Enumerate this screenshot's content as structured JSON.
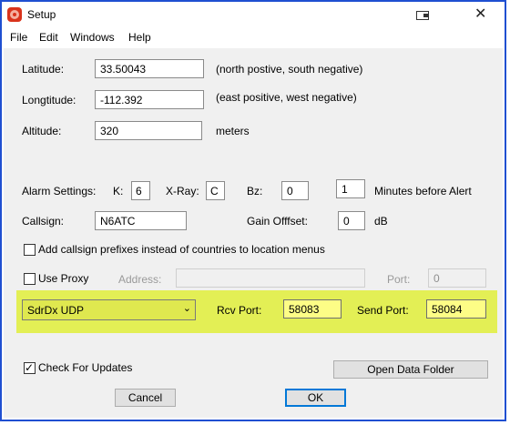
{
  "window": {
    "title": "Setup"
  },
  "menu": [
    "File",
    "Edit",
    "Windows",
    "Help"
  ],
  "location": {
    "latitude_label": "Latitude:",
    "latitude_value": "33.50043",
    "latitude_note": "(north postive, south negative)",
    "longitude_label": "Longtitude:",
    "longitude_value": "-112.392",
    "longitude_note": "(east positive, west negative)",
    "altitude_label": "Altitude:",
    "altitude_value": "320",
    "altitude_unit": "meters"
  },
  "alarm": {
    "label": "Alarm Settings:",
    "k_label": "K:",
    "k_value": "6",
    "xray_label": "X-Ray:",
    "xray_value": "C",
    "bz_label": "Bz:",
    "bz_value": "0",
    "minutes_value": "1",
    "minutes_label": "Minutes before Alert"
  },
  "callsign": {
    "label": "Callsign:",
    "value": "N6ATC"
  },
  "gain": {
    "label": "Gain Offfset:",
    "value": "0",
    "unit": "dB"
  },
  "prefix_option": {
    "label": "Add callsign prefixes instead of countries to location menus",
    "checked": false
  },
  "proxy": {
    "label": "Use Proxy",
    "checked": false,
    "address_label": "Address:",
    "address_value": "",
    "port_label": "Port:",
    "port_value": "0"
  },
  "udp": {
    "mode_value": "SdrDx UDP",
    "rcv_port_label": "Rcv Port:",
    "rcv_port_value": "58083",
    "send_port_label": "Send Port:",
    "send_port_value": "58084"
  },
  "updates": {
    "label": "Check For Updates",
    "checked": true
  },
  "buttons": {
    "open_data_folder": "Open Data Folder",
    "cancel": "Cancel",
    "ok": "OK"
  },
  "colors": {
    "highlight": "#e3ef55",
    "field_yellow": "#fdfd86",
    "window_border": "#1f4fd1"
  }
}
